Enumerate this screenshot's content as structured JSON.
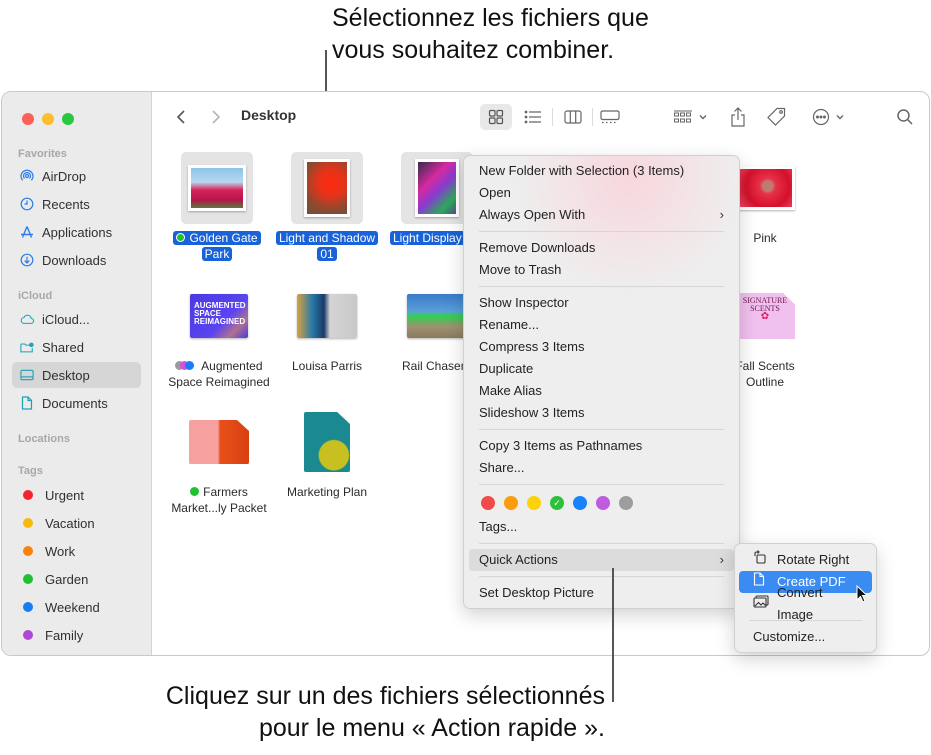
{
  "callouts": {
    "top_line1": "Sélectionnez les fichiers que",
    "top_line2": "vous souhaitez combiner.",
    "bottom_line1": "Cliquez sur un des fichiers sélectionnés",
    "bottom_line2": "pour le menu « Action rapide »."
  },
  "window": {
    "traffic_colors": {
      "close": "#fe5f57",
      "minimize": "#febc2e",
      "zoom": "#28c840"
    }
  },
  "sidebar": {
    "sections": {
      "favorites": "Favorites",
      "icloud": "iCloud",
      "locations": "Locations",
      "tags": "Tags"
    },
    "favorites": [
      {
        "label": "AirDrop",
        "icon": "airdrop-icon"
      },
      {
        "label": "Recents",
        "icon": "clock-icon"
      },
      {
        "label": "Applications",
        "icon": "applications-icon"
      },
      {
        "label": "Downloads",
        "icon": "download-icon"
      }
    ],
    "icloud": [
      {
        "label": "iCloud...",
        "icon": "cloud-icon"
      },
      {
        "label": "Shared",
        "icon": "shared-folder-icon"
      },
      {
        "label": "Desktop",
        "icon": "desktop-icon",
        "active": true
      },
      {
        "label": "Documents",
        "icon": "document-icon"
      }
    ],
    "tags": [
      {
        "label": "Urgent",
        "color": "#f5232d"
      },
      {
        "label": "Vacation",
        "color": "#f8b90e"
      },
      {
        "label": "Work",
        "color": "#f7820e"
      },
      {
        "label": "Garden",
        "color": "#1fc22e"
      },
      {
        "label": "Weekend",
        "color": "#1a7cf5"
      },
      {
        "label": "Family",
        "color": "#b048d6"
      }
    ]
  },
  "toolbar": {
    "title": "Desktop",
    "back_icon": "chevron-left-icon",
    "forward_icon": "chevron-right-icon",
    "view_modes": [
      "icon-view",
      "list-view",
      "column-view",
      "gallery-view"
    ],
    "active_view": "icon-view"
  },
  "files": [
    {
      "name_line1": "Golden Gate",
      "name_line2": "Park",
      "selected": true,
      "tag": "#1fc22e"
    },
    {
      "name_line1": "Light and Shadow",
      "name_line2": "01",
      "selected": true
    },
    {
      "name_line1": "Light Display",
      "name_line2": "",
      "selected": true
    },
    {
      "name_line1": "Pink",
      "name_line2": ""
    },
    {
      "name_line1": "Augmented",
      "name_line2": "Space Reimagined",
      "tags": [
        "#9a9a9a",
        "#d54fe0",
        "#1a7cf5"
      ]
    },
    {
      "name_line1": "Louisa Parris",
      "name_line2": ""
    },
    {
      "name_line1": "Rail Chaser",
      "name_line2": ""
    },
    {
      "name_line1": "Fall Scents",
      "name_line2": "Outline"
    },
    {
      "name_line1": "Farmers",
      "name_line2": "Market...ly Packet",
      "tag": "#1fc22e"
    },
    {
      "name_line1": "Marketing Plan",
      "name_line2": ""
    }
  ],
  "context_menu": {
    "groups": [
      [
        {
          "label": "New Folder with Selection (3 Items)"
        },
        {
          "label": "Open"
        },
        {
          "label": "Always Open With",
          "submenu": true
        }
      ],
      [
        {
          "label": "Remove Downloads"
        },
        {
          "label": "Move to Trash"
        }
      ],
      [
        {
          "label": "Show Inspector"
        },
        {
          "label": "Rename..."
        },
        {
          "label": "Compress 3 Items"
        },
        {
          "label": "Duplicate"
        },
        {
          "label": "Make Alias"
        },
        {
          "label": "Slideshow 3 Items"
        }
      ],
      [
        {
          "label": "Copy 3 Items as Pathnames"
        },
        {
          "label": "Share..."
        }
      ]
    ],
    "tag_colors": [
      "#f24a4a",
      "#fb9c0c",
      "#fdd20a",
      "#2dc13a",
      "#1a82fb",
      "#bf5bde",
      "#9d9d9f"
    ],
    "checked_tag_index": 3,
    "tags_label": "Tags...",
    "quick_actions_label": "Quick Actions",
    "set_desktop_label": "Set Desktop Picture"
  },
  "quick_actions_menu": {
    "items": [
      {
        "label": "Rotate Right",
        "icon": "rotate-right-icon"
      },
      {
        "label": "Create PDF",
        "icon": "pdf-document-icon",
        "active": true
      },
      {
        "label": "Convert Image",
        "icon": "convert-image-icon"
      }
    ],
    "customize_label": "Customize..."
  }
}
